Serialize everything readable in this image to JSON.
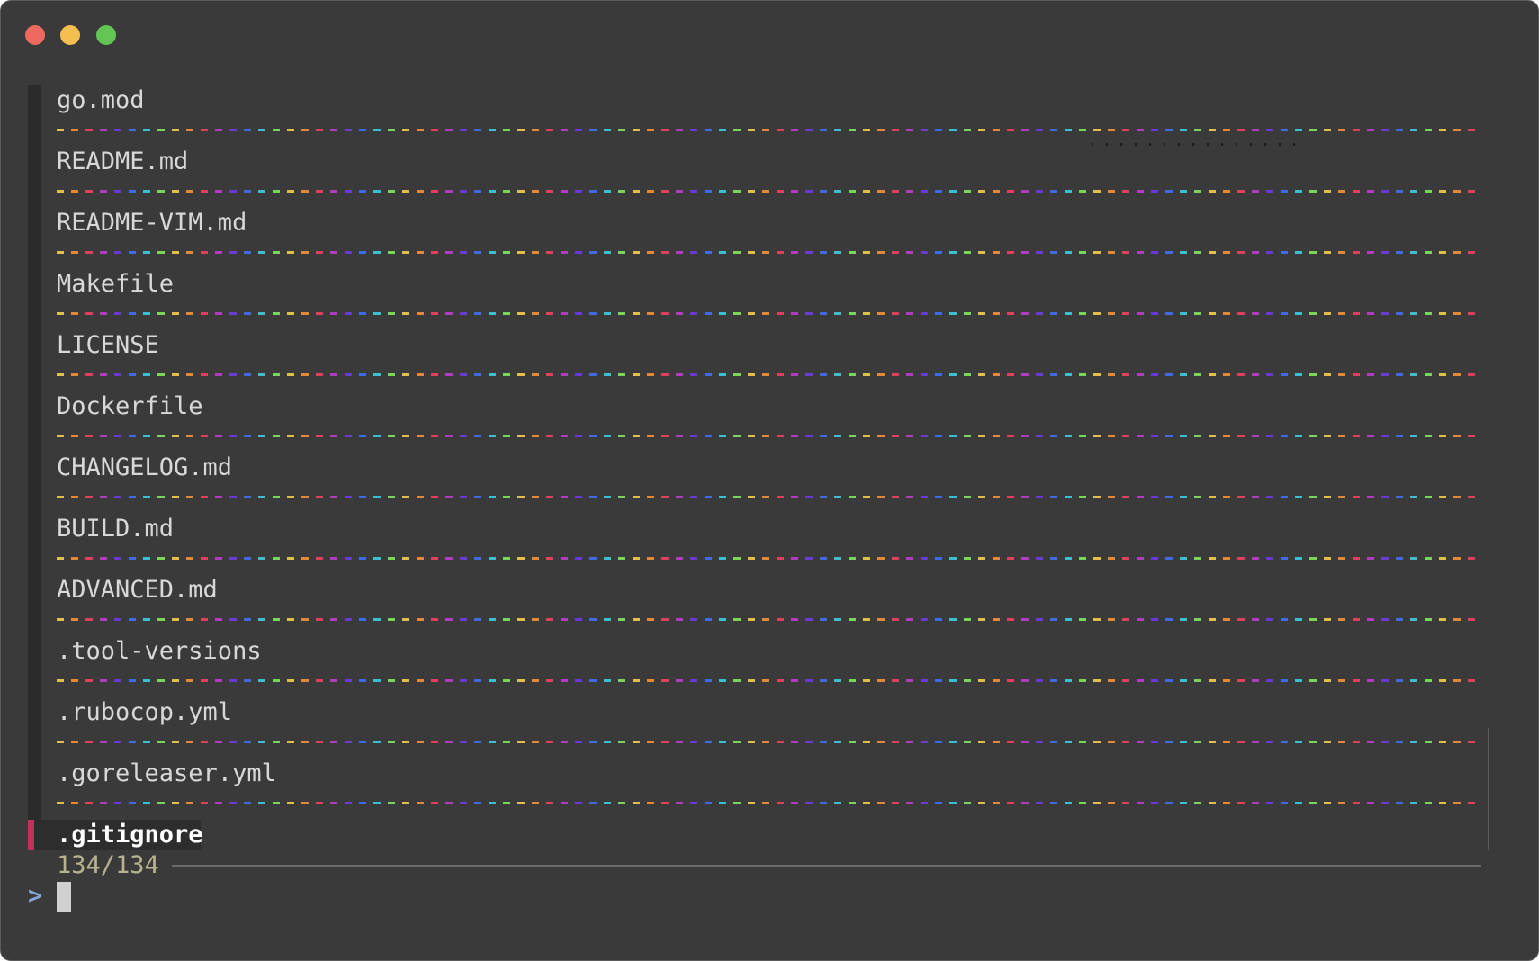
{
  "window": {
    "controls": [
      "close",
      "minimize",
      "zoom"
    ]
  },
  "list": {
    "items": [
      "go.mod",
      "README.md",
      "README-VIM.md",
      "Makefile",
      "LICENSE",
      "Dockerfile",
      "CHANGELOG.md",
      "BUILD.md",
      "ADVANCED.md",
      ".tool-versions",
      ".rubocop.yml",
      ".goreleaser.yml"
    ],
    "selected": ".gitignore"
  },
  "status": {
    "match_count": "134/134"
  },
  "prompt": {
    "symbol": ">",
    "query": ""
  },
  "colors": {
    "background": "#3a3a3a",
    "pointer": "#c4305c",
    "prompt": "#86a7d6",
    "info": "#b7b38e"
  }
}
